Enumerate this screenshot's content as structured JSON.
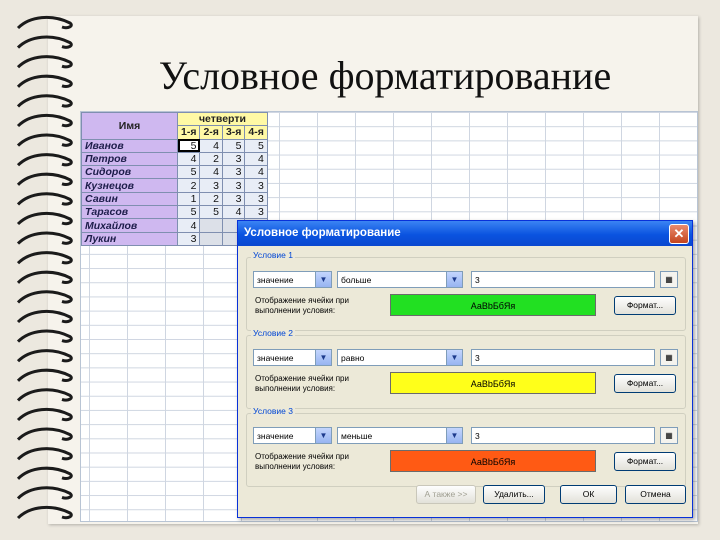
{
  "title": "Условное форматирование",
  "sheet": {
    "header_name": "Имя",
    "header_group": "четверти",
    "quarters": [
      "1-я",
      "2-я",
      "3-я",
      "4-я"
    ],
    "rows": [
      {
        "name": "Иванов",
        "values": [
          "5",
          "4",
          "5",
          "5"
        ]
      },
      {
        "name": "Петров",
        "values": [
          "4",
          "2",
          "3",
          "4"
        ]
      },
      {
        "name": "Сидоров",
        "values": [
          "5",
          "4",
          "3",
          "4"
        ]
      },
      {
        "name": "Кузнецов",
        "values": [
          "2",
          "3",
          "3",
          "3"
        ]
      },
      {
        "name": "Савин",
        "values": [
          "1",
          "2",
          "3",
          "3"
        ]
      },
      {
        "name": "Тарасов",
        "values": [
          "5",
          "5",
          "4",
          "3"
        ]
      },
      {
        "name": "Михайлов",
        "values": [
          "4",
          "",
          "",
          ""
        ]
      },
      {
        "name": "Лукин",
        "values": [
          "3",
          "",
          "",
          ""
        ]
      }
    ]
  },
  "dialog": {
    "title": "Условное форматирование",
    "close_label": "✕",
    "display_label_line1": "Отображение ячейки при",
    "display_label_line2": "выполнении условия:",
    "preview_text": "АаВbБбЯя",
    "format_button": "Формат...",
    "conditions": [
      {
        "label": "Условие 1",
        "type": "значение",
        "operator": "больше",
        "value": "3",
        "color": "#22e022"
      },
      {
        "label": "Условие 2",
        "type": "значение",
        "operator": "равно",
        "value": "3",
        "color": "#ffff1a"
      },
      {
        "label": "Условие 3",
        "type": "значение",
        "operator": "меньше",
        "value": "3",
        "color": "#ff5a14"
      }
    ],
    "buttons": {
      "also": "А также >>",
      "delete": "Удалить...",
      "ok": "ОК",
      "cancel": "Отмена"
    }
  }
}
